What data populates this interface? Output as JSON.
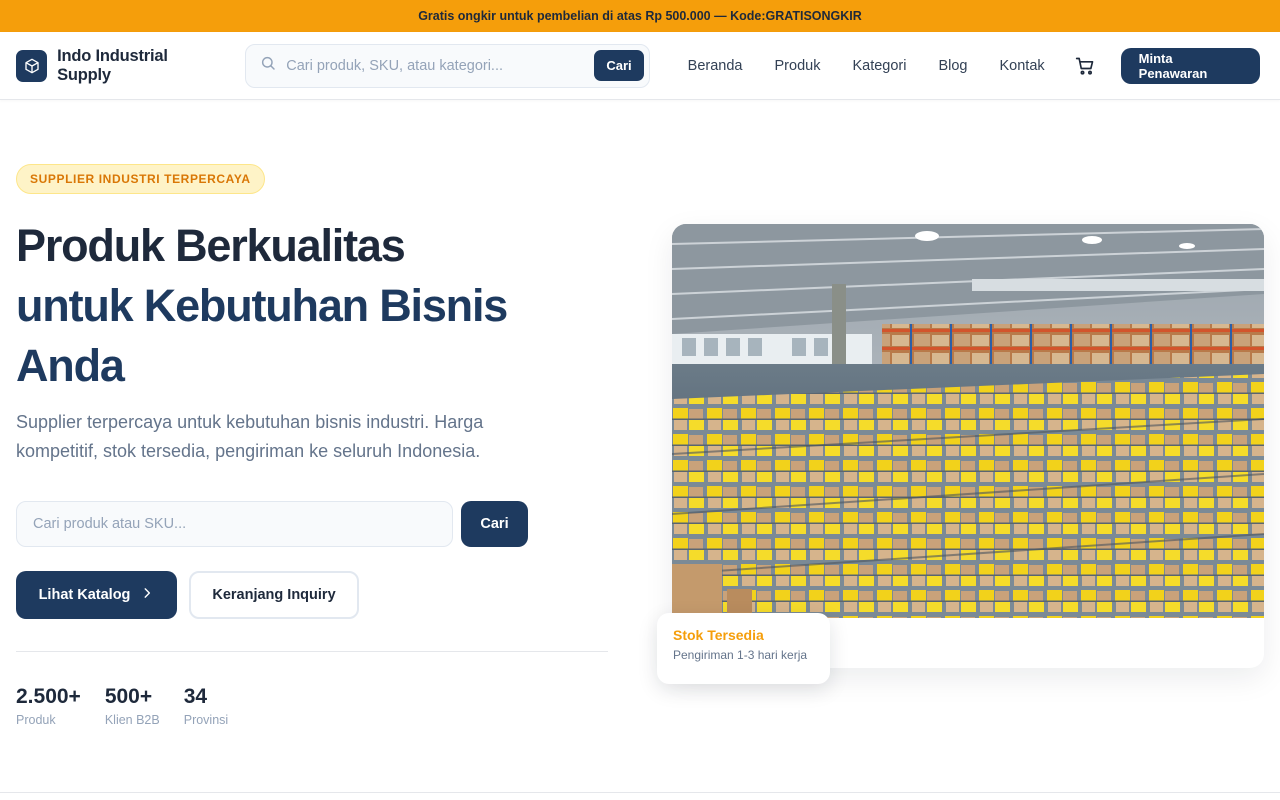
{
  "promo": {
    "text": "Gratis ongkir untuk pembelian di atas Rp 500.000 — Kode: ",
    "code": "GRATISONGKIR",
    "color": "#f59e0b"
  },
  "header": {
    "brand": "Indo Industrial Supply",
    "logo_icon": "box-icon",
    "search_placeholder": "Cari produk, SKU, atau kategori...",
    "search_button": "Cari",
    "nav": [
      "Beranda",
      "Produk",
      "Kategori",
      "Blog",
      "Kontak"
    ],
    "cart_icon": "cart-icon",
    "cta": "Minta Penawaran"
  },
  "hero": {
    "badge": "SUPPLIER INDUSTRI TERPERCAYA",
    "title_line1": "Produk Berkualitas",
    "title_accent": "untuk Kebutuhan Bisnis Anda",
    "subtitle": "Supplier terpercaya untuk kebutuhan bisnis industri. Harga kompetitif, stok tersedia, pengiriman ke seluruh Indonesia.",
    "search_placeholder": "Cari produk atau SKU...",
    "search_button": "Cari",
    "catalog_button": "Lihat Katalog",
    "inquiry_button": "Keranjang Inquiry",
    "stats": [
      {
        "value": "2.500+",
        "label": "Produk"
      },
      {
        "value": "500+",
        "label": "Klien B2B"
      },
      {
        "value": "34",
        "label": "Provinsi"
      }
    ],
    "stock_title": "Stok Tersedia",
    "stock_subtitle": "Pengiriman 1-3 hari kerja"
  },
  "colors": {
    "primary": "#1e3a5f",
    "accent": "#f59e0b"
  }
}
